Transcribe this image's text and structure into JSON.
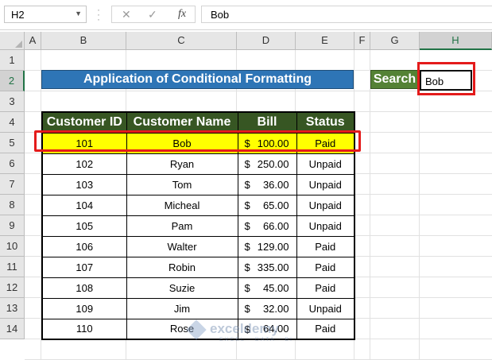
{
  "formula_bar": {
    "name_box": "H2",
    "fx_label": "fx",
    "formula": "Bob"
  },
  "columns": [
    "A",
    "B",
    "C",
    "D",
    "E",
    "F",
    "G",
    "H"
  ],
  "rows": [
    "1",
    "2",
    "3",
    "4",
    "5",
    "6",
    "7",
    "8",
    "9",
    "10",
    "11",
    "12",
    "13",
    "14"
  ],
  "selected_cell": "H2",
  "sheet": {
    "title": "Application of Conditional Formatting",
    "search_label": "Search",
    "search_value": "Bob",
    "headers": [
      "Customer ID",
      "Customer Name",
      "Bill",
      "Status"
    ],
    "currency_symbol": "$",
    "records": [
      {
        "id": "101",
        "name": "Bob",
        "bill": "100.00",
        "status": "Paid",
        "highlighted": true
      },
      {
        "id": "102",
        "name": "Ryan",
        "bill": "250.00",
        "status": "Unpaid"
      },
      {
        "id": "103",
        "name": "Tom",
        "bill": "36.00",
        "status": "Unpaid"
      },
      {
        "id": "104",
        "name": "Micheal",
        "bill": "65.00",
        "status": "Unpaid"
      },
      {
        "id": "105",
        "name": "Pam",
        "bill": "66.00",
        "status": "Unpaid"
      },
      {
        "id": "106",
        "name": "Walter",
        "bill": "129.00",
        "status": "Paid"
      },
      {
        "id": "107",
        "name": "Robin",
        "bill": "335.00",
        "status": "Paid"
      },
      {
        "id": "108",
        "name": "Suzie",
        "bill": "45.00",
        "status": "Paid"
      },
      {
        "id": "109",
        "name": "Jim",
        "bill": "32.00",
        "status": "Unpaid"
      },
      {
        "id": "110",
        "name": "Rose",
        "bill": "64.00",
        "status": "Paid"
      }
    ]
  },
  "watermark": {
    "name": "exceldemy",
    "tagline": "EXCEL · DATA · BI"
  },
  "colors": {
    "title_bg": "#2e75b6",
    "header_bg": "#375623",
    "search_bg": "#548235",
    "highlight_fill": "#ffff00",
    "callout_border": "#e41b1b"
  }
}
